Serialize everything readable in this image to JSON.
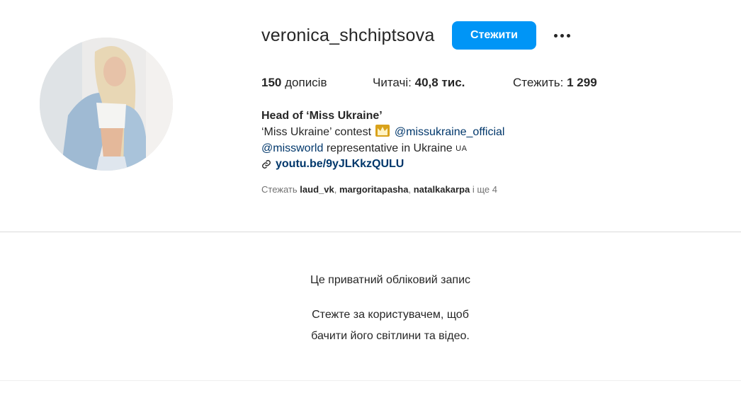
{
  "profile": {
    "username": "veronica_shchiptsova",
    "follow_label": "Стежити",
    "more_icon": "more-options-icon",
    "stats": {
      "posts_count": "150",
      "posts_label": "дописів",
      "followers_label": "Читачі:",
      "followers_count": "40,8 тис.",
      "following_label": "Стежить:",
      "following_count": "1 299"
    },
    "bio": {
      "name": "Head of ‘Miss Ukraine’",
      "line1_text": "‘Miss Ukraine’ contest",
      "line1_icon": "crown-emoji",
      "line1_mention": "@missukraine_official",
      "line2_mention": "@missworld",
      "line2_text": "representative in Ukraine",
      "line2_flag": "UA",
      "link_icon": "link-icon",
      "link": "youtu.be/9yJLKkzQULU"
    },
    "followed_by": {
      "prefix": "Стежать",
      "users": [
        "laud_vk",
        "margoritapasha",
        "natalkakarpa"
      ],
      "suffix": "і ще 4"
    }
  },
  "private_notice": {
    "title": "Це приватний обліковий запис",
    "line1": "Стежте за користувачем, щоб",
    "line2": "бачити його світлини та відео."
  },
  "colors": {
    "accent": "#0095f6",
    "link": "#00376b",
    "text": "#262626",
    "muted": "#737373",
    "divider": "#dbdbdb"
  }
}
